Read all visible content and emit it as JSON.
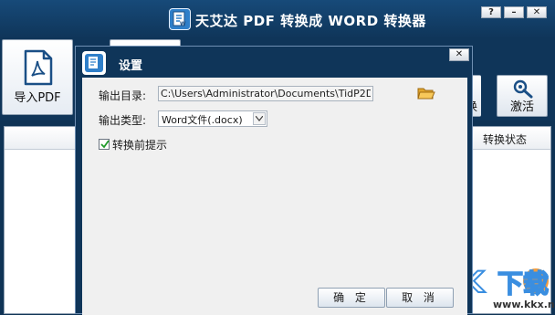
{
  "window": {
    "title": "天艾达 PDF 转换成 WORD 转换器",
    "controls": {
      "help": "?",
      "minimize": "–",
      "close": "✕"
    }
  },
  "toolbar": {
    "import_pdf_label": "导入PDF",
    "side_button_partial_label": "换",
    "activate_label": "激活"
  },
  "file_list": {
    "column_status": "转换状态"
  },
  "dialog": {
    "title": "设置",
    "close": "✕",
    "output_dir_label": "输出目录:",
    "output_dir_value": "C:\\Users\\Administrator\\Documents\\TidP2D",
    "output_type_label": "输出类型:",
    "output_type_value": "Word文件(.docx)",
    "prompt_checkbox_label": "转换前提示",
    "prompt_checked": true,
    "ok_label": "确 定",
    "cancel_label": "取 消"
  },
  "watermark": {
    "text": "KK下载",
    "url": "www.kkx.net"
  },
  "colors": {
    "window_bg": "#0f3355",
    "title_text": "#ffffff",
    "logo_blue": "#2f7fc9",
    "dialog_body": "#f0f0f0"
  }
}
